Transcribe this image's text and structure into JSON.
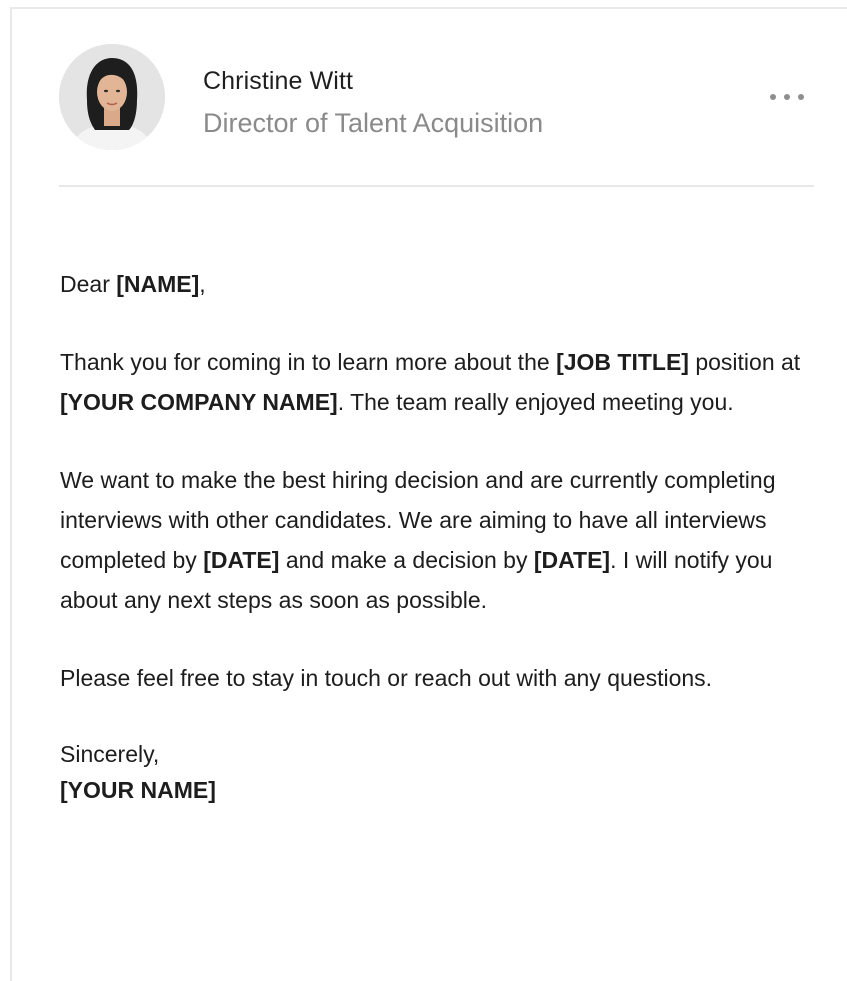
{
  "sender": {
    "name": "Christine Witt",
    "title": "Director of Talent Acquisition",
    "more_icon": "more-horizontal-icon"
  },
  "letter": {
    "greeting": {
      "prefix": "Dear ",
      "name": "[NAME]",
      "suffix": ","
    },
    "p1": {
      "t1": "Thank you for coming in to learn more about the ",
      "job": "[JOB TITLE]",
      "t2": " position at ",
      "company": "[YOUR COMPANY NAME]",
      "t3": ". The team really enjoyed meeting you."
    },
    "p2": {
      "t1": "We want to make the best hiring decision and are currently completing interviews with other candidates. We are aiming to have all interviews completed by ",
      "date1": "[DATE]",
      "t2": " and make a decision by ",
      "date2": "[DATE]",
      "t3": ". I will notify you about any next steps as soon as possible."
    },
    "p3": "Please feel free to stay in touch or reach out with any questions.",
    "closing": "Sincerely,",
    "signature": "[YOUR NAME]"
  }
}
